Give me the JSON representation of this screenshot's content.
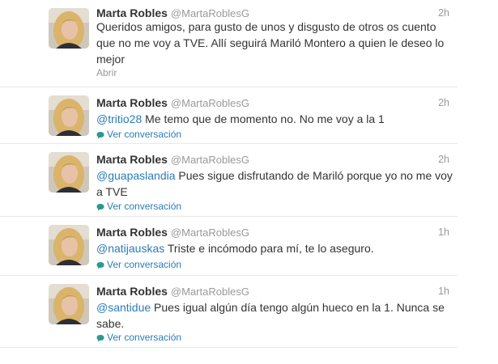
{
  "colors": {
    "link": "#2b7bb9",
    "muted": "#999999",
    "text": "#333333",
    "divider": "#e8e8e8"
  },
  "tweets": [
    {
      "name": "Marta Robles",
      "handle": "@MartaRoblesG",
      "time": "2h",
      "mention": "",
      "text": "Queridos amigos, para gusto de unos y disgusto de otros os cuento que no me voy a TVE. Allí seguirá Mariló Montero a quien le deseo lo mejor",
      "action": "Abrir",
      "action_icon": ""
    },
    {
      "name": "Marta Robles",
      "handle": "@MartaRoblesG",
      "time": "2h",
      "mention": "@tritio28",
      "text": " Me temo que de momento no. No me voy a la 1",
      "action": "Ver conversación",
      "action_icon": "speech-bubble-icon"
    },
    {
      "name": "Marta Robles",
      "handle": "@MartaRoblesG",
      "time": "2h",
      "mention": "@guapaslandia",
      "text": " Pues sigue disfrutando de Mariló porque yo no me voy a TVE",
      "action": "Ver conversación",
      "action_icon": "speech-bubble-icon"
    },
    {
      "name": "Marta Robles",
      "handle": "@MartaRoblesG",
      "time": "1h",
      "mention": "@natijauskas",
      "text": " Triste e incómodo para mí, te lo aseguro.",
      "action": "Ver conversación",
      "action_icon": "speech-bubble-icon"
    },
    {
      "name": "Marta Robles",
      "handle": "@MartaRoblesG",
      "time": "1h",
      "mention": "@santidue",
      "text": " Pues igual algún día tengo algún hueco en la 1. Nunca se sabe.",
      "action": "Ver conversación",
      "action_icon": "speech-bubble-icon"
    }
  ]
}
